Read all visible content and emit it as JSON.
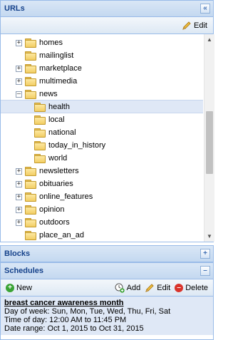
{
  "urls_panel": {
    "title": "URLs",
    "collapse_icon": "double-chevron-left-icon",
    "edit_label": "Edit",
    "tree": [
      {
        "label": "homes",
        "expandable": true,
        "expanded": false
      },
      {
        "label": "mailinglist",
        "expandable": false
      },
      {
        "label": "marketplace",
        "expandable": true,
        "expanded": false
      },
      {
        "label": "multimedia",
        "expandable": true,
        "expanded": false
      },
      {
        "label": "news",
        "expandable": true,
        "expanded": true
      },
      {
        "label": "health",
        "expandable": false,
        "selected": true
      },
      {
        "label": "local",
        "expandable": false
      },
      {
        "label": "national",
        "expandable": false
      },
      {
        "label": "today_in_history",
        "expandable": false
      },
      {
        "label": "world",
        "expandable": false
      },
      {
        "label": "newsletters",
        "expandable": true,
        "expanded": false
      },
      {
        "label": "obituaries",
        "expandable": true,
        "expanded": false
      },
      {
        "label": "online_features",
        "expandable": true,
        "expanded": false
      },
      {
        "label": "opinion",
        "expandable": true,
        "expanded": false
      },
      {
        "label": "outdoors",
        "expandable": true,
        "expanded": false
      },
      {
        "label": "place_an_ad",
        "expandable": false
      }
    ]
  },
  "blocks_panel": {
    "title": "Blocks",
    "expand_icon": "plus-icon"
  },
  "schedules_panel": {
    "title": "Schedules",
    "collapse_icon": "minus-icon",
    "new_label": "New",
    "add_label": "Add",
    "edit_label": "Edit",
    "delete_label": "Delete",
    "item": {
      "title": "breast cancer awareness month",
      "day_of_week": "Day of week: Sun, Mon, Tue, Wed, Thu, Fri, Sat",
      "time_of_day": "Time of day: 12:00 AM to 11:45 PM",
      "date_range": "Date range: Oct 1, 2015 to Oct 31, 2015"
    }
  },
  "colors": {
    "header_text": "#15428b",
    "border": "#99bbe8",
    "selection": "#dfe8f6",
    "new_icon": "#3aa335",
    "delete_icon": "#d9342b"
  }
}
